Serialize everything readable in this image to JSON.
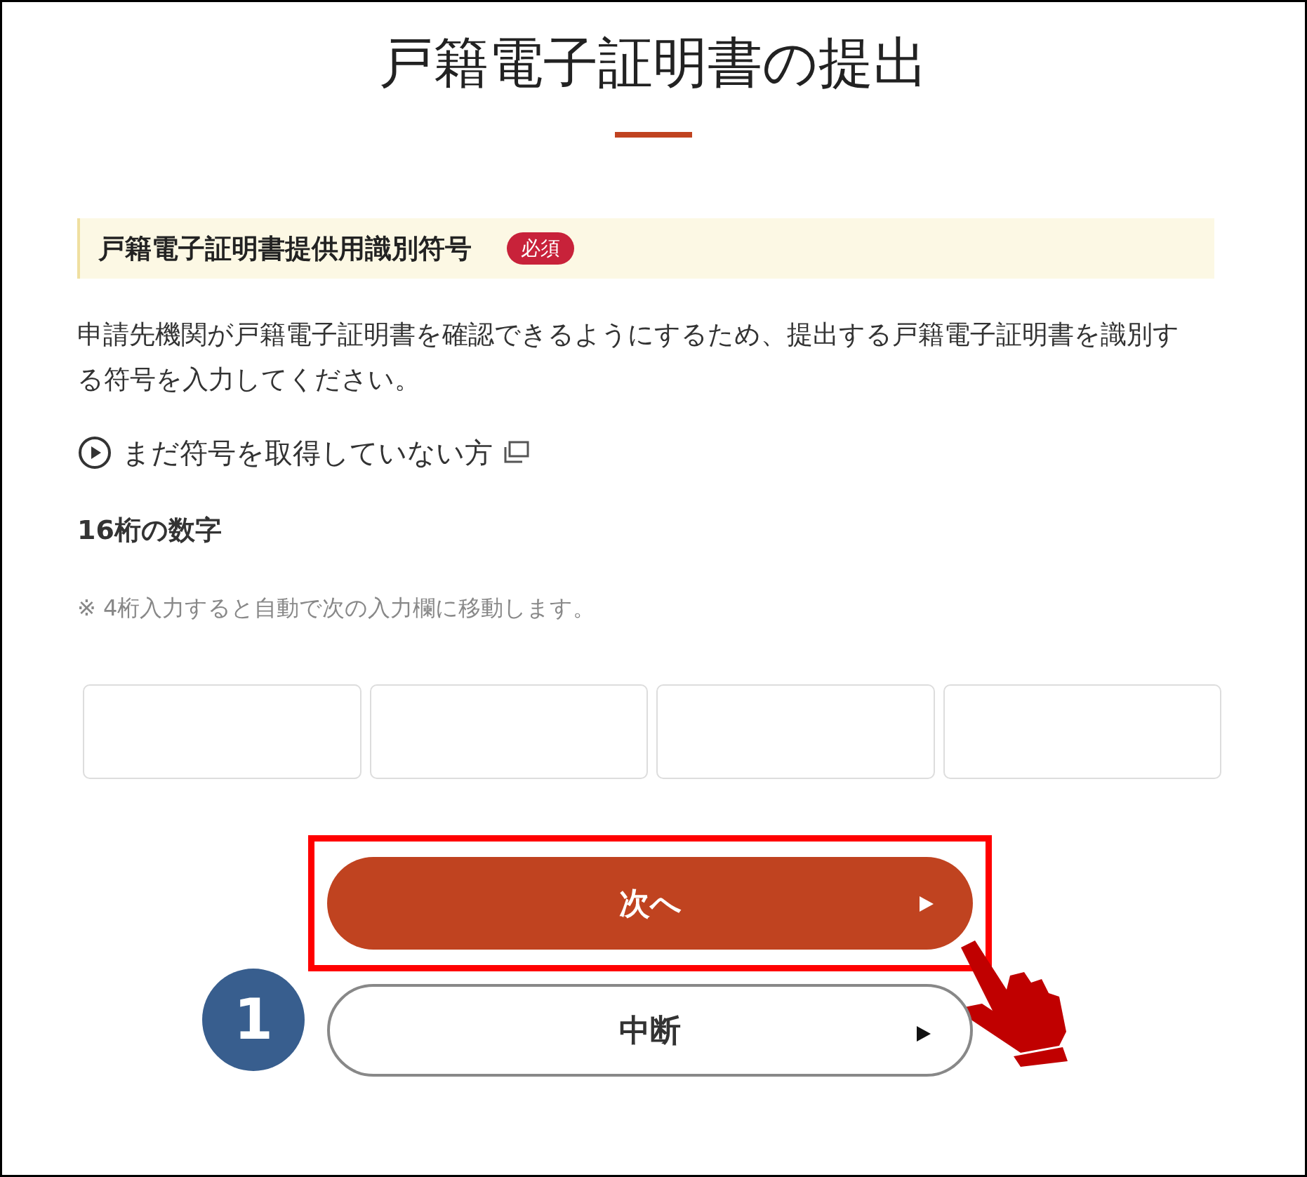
{
  "title": "戸籍電子証明書の提出",
  "field": {
    "label": "戸籍電子証明書提供用識別符号",
    "badge": "必須",
    "description": "申請先機関が戸籍電子証明書を確認できるようにするため、提出する戸籍電子証明書を識別する符号を入力してください。",
    "link": "まだ符号を取得していない方",
    "format": "16桁の数字",
    "note": "※ 4桁入力すると自動で次の入力欄に移動します。"
  },
  "buttons": [
    {
      "label": "次へ",
      "kind": "primary",
      "highlighted": true
    },
    {
      "label": "中断",
      "kind": "secondary",
      "highlighted": false
    }
  ],
  "annotation": {
    "step": "1"
  }
}
